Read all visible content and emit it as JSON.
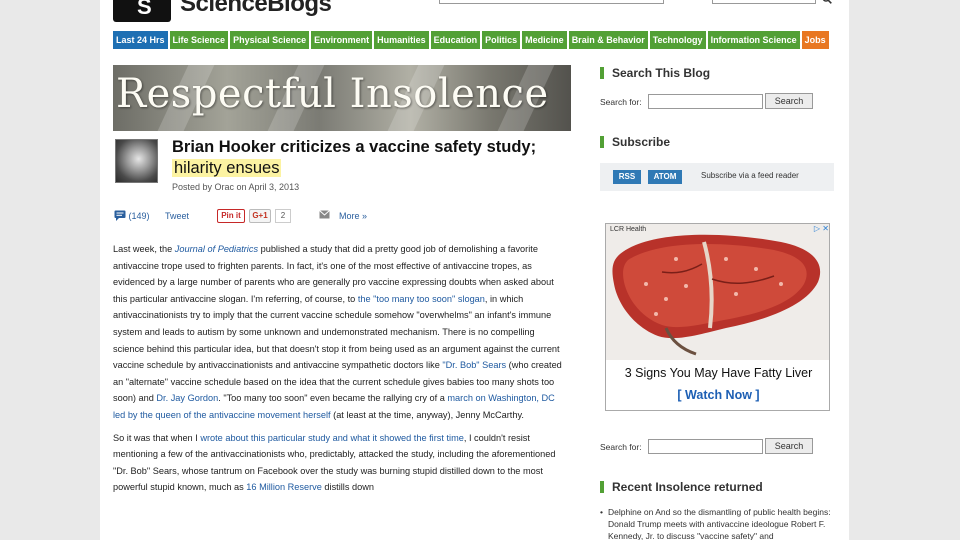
{
  "header": {
    "logo_mark": "S",
    "logo_text": "ScienceBlogs",
    "search_icon": "search-icon"
  },
  "nav": {
    "items": [
      "Last 24 Hrs",
      "Life Science",
      "Physical Science",
      "Environment",
      "Humanities",
      "Education",
      "Politics",
      "Medicine",
      "Brain & Behavior",
      "Technology",
      "Information Science",
      "Jobs"
    ]
  },
  "banner": {
    "title": "Respectful Insolence"
  },
  "post": {
    "title_part1": "Brian Hooker criticizes a vaccine safety study;",
    "title_part2": "hilarity ensues",
    "meta": "Posted by Orac on April 3, 2013"
  },
  "share": {
    "comments": "(149)",
    "tweet": "Tweet",
    "pin": "Pin it",
    "gplus": "G+1",
    "gplus_count": "2",
    "more": "More »"
  },
  "article": {
    "p1_a": "Last week, the ",
    "p1_journal": "Journal of Pediatrics",
    "p1_b": " published a study that did a pretty good job of demolishing a favorite antivaccine trope used to frighten parents. In fact, it's one of the most effective of antivaccine tropes, as evidenced by a large number of parents who are generally pro vaccine expressing doubts when asked about this particular antivaccine slogan. I'm referring, of course, to ",
    "p1_link1": "the \"too many too soon\" slogan",
    "p1_c": ", in which antivaccinationists try to imply that the current vaccine schedule somehow \"overwhelms\" an infant's immune system and leads to autism by some unknown and undemonstrated mechanism. There is no compelling science behind this particular idea, but that doesn't stop it from being used as an argument against the current vaccine schedule by antivaccinationists and antivaccine sympathetic doctors like ",
    "p1_link2": "\"Dr. Bob\" Sears",
    "p1_d": " (who created an \"alternate\" vaccine schedule based on the idea that the current schedule gives babies too many shots too soon) and ",
    "p1_link3": "Dr. Jay Gordon",
    "p1_e": ". \"Too many too soon\" even became the rallying cry of a ",
    "p1_link4": "march on Washington, DC led by the queen of the antivaccine movement herself",
    "p1_f": " (at least at the time, anyway), Jenny McCarthy.",
    "p2_a": "So it was that when I ",
    "p2_link1": "wrote about this particular study and what it showed the first time",
    "p2_b": ", I couldn't resist mentioning a few of the antivaccinationists who, predictably, attacked the study, including the aforementioned \"Dr. Bob\" Sears, whose tantrum on Facebook over the study was burning stupid distilled down to the most powerful stupid known, much as ",
    "p2_link2": "16 Million Reserve",
    "p2_c": " distills down"
  },
  "sidebar": {
    "search_title": "Search This Blog",
    "search_label": "Search for:",
    "search_button": "Search",
    "subscribe_title": "Subscribe",
    "rss": "RSS",
    "atom": "ATOM",
    "subscribe_text": "Subscribe via a feed reader",
    "ad_label": "LCR Health",
    "ad_headline": "3 Signs You May Have Fatty Liver",
    "ad_cta": "[ Watch Now ]",
    "search2_label": "Search for:",
    "search2_button": "Search",
    "recent_title": "Recent Insolence returned",
    "recent_item": "Delphine on And so the dismantling of public health begins: Donald Trump meets with antivaccine ideologue Robert F. Kennedy, Jr. to discuss \"vaccine safety\" and"
  },
  "colors": {
    "nav_green": "#52a035",
    "nav_blue": "#1e6fb3",
    "nav_orange": "#e87722",
    "highlight_yellow": "#f9f29c",
    "link_blue": "#1f5aa0"
  }
}
